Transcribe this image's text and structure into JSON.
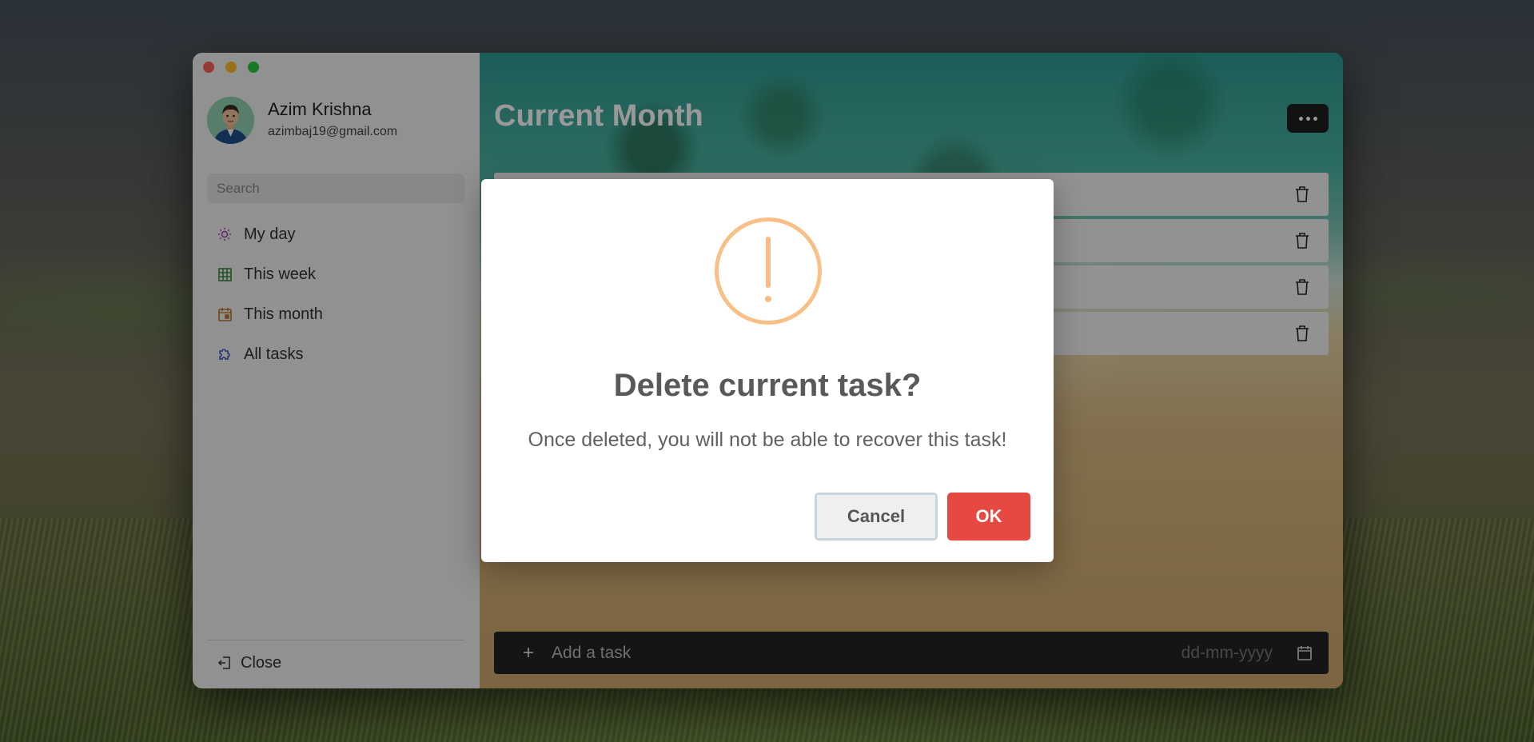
{
  "window_controls": {
    "close": "close",
    "minimize": "minimize",
    "zoom": "zoom"
  },
  "user": {
    "name": "Azim Krishna",
    "email": "azimbaj19@gmail.com"
  },
  "search": {
    "placeholder": "Search"
  },
  "nav": {
    "items": [
      {
        "label": "My day",
        "icon": "sun-icon",
        "color": "#a23ea8"
      },
      {
        "label": "This week",
        "icon": "grid-icon",
        "color": "#3a8a4a"
      },
      {
        "label": "This month",
        "icon": "calendar-icon",
        "color": "#b5782a"
      },
      {
        "label": "All tasks",
        "icon": "puzzle-icon",
        "color": "#3a4fc4"
      }
    ]
  },
  "sidebar_footer": {
    "close_label": "Close"
  },
  "main": {
    "title": "Current Month",
    "add_task": {
      "placeholder": "Add a task",
      "date_placeholder": "dd-mm-yyyy"
    }
  },
  "dialog": {
    "title": "Delete current task?",
    "text": "Once deleted, you will not be able to recover this task!",
    "cancel_label": "Cancel",
    "ok_label": "OK",
    "icon": "warning-icon",
    "icon_color": "#f8bb86",
    "ok_color": "#e64942"
  }
}
